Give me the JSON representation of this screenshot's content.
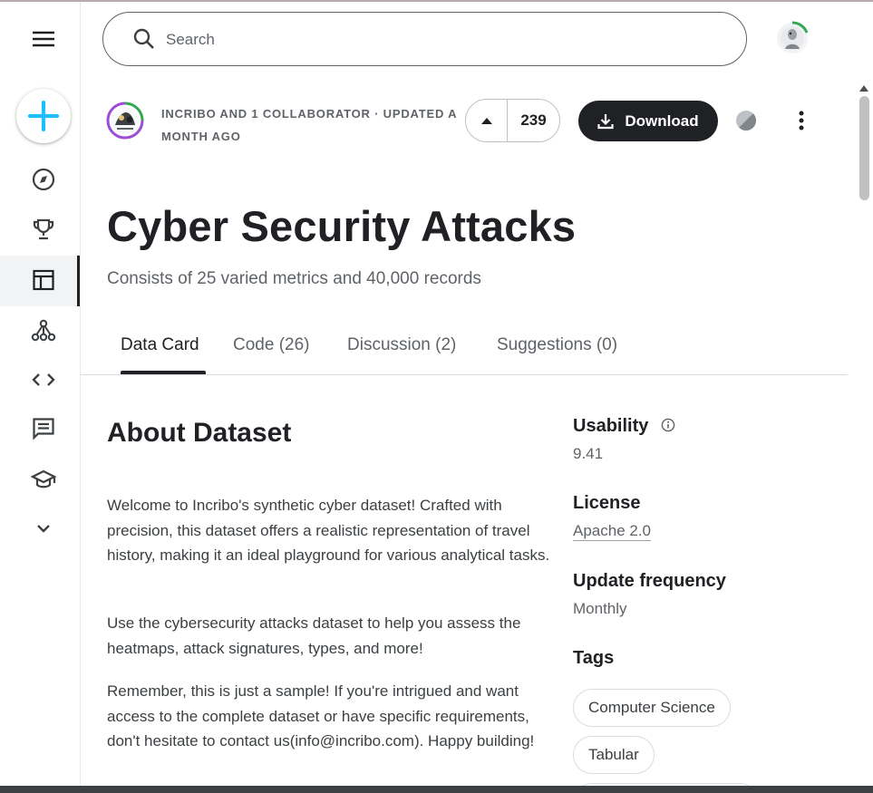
{
  "search": {
    "placeholder": "Search"
  },
  "sidebar": {
    "items": [
      {
        "name": "menu-icon"
      },
      {
        "name": "create-icon"
      },
      {
        "name": "compass-icon"
      },
      {
        "name": "trophy-icon"
      },
      {
        "name": "table-icon",
        "active": true
      },
      {
        "name": "model-icon"
      },
      {
        "name": "code-icon"
      },
      {
        "name": "discussion-icon"
      },
      {
        "name": "learn-icon"
      },
      {
        "name": "chevron-down-icon"
      }
    ]
  },
  "dataset": {
    "meta": "INCRIBO AND 1 COLLABORATOR · UPDATED A MONTH AGO",
    "upvotes": "239",
    "download_label": "Download",
    "title": "Cyber Security Attacks",
    "subtitle": "Consists of 25 varied metrics and 40,000 records"
  },
  "tabs": [
    {
      "label": "Data Card",
      "active": true
    },
    {
      "label": "Code (26)"
    },
    {
      "label": "Discussion (2)"
    },
    {
      "label": "Suggestions (0)"
    }
  ],
  "about": {
    "heading": "About Dataset",
    "paragraphs": [
      "Welcome to Incribo's synthetic cyber dataset! Crafted with precision, this dataset offers a realistic representation of travel history, making it an ideal playground for various analytical tasks.",
      "Use the cybersecurity attacks dataset to help you assess the heatmaps, attack signatures, types, and more!",
      "Remember, this is just a sample! If you're intrigued and want access to the complete dataset or have specific requirements, don't hesitate to contact us(info@incribo.com). Happy building!"
    ]
  },
  "details": {
    "usability_label": "Usability",
    "usability_value": "9.41",
    "license_label": "License",
    "license_value": "Apache 2.0",
    "frequency_label": "Update frequency",
    "frequency_value": "Monthly",
    "tags_label": "Tags",
    "tags": [
      "Computer Science",
      "Tabular"
    ]
  },
  "colors": {
    "primary_text": "#202124",
    "secondary_text": "#5f6368",
    "accent_blue": "#20beff",
    "download_bg": "#202124",
    "progress_green": "#34a853"
  }
}
